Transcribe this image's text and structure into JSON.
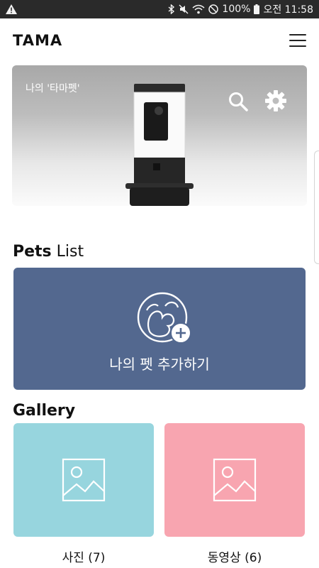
{
  "status_bar": {
    "battery": "100%",
    "time": "오전 11:58"
  },
  "app": {
    "logo": "TAMA"
  },
  "hero": {
    "label": "나의 '타마펫'"
  },
  "pets": {
    "title_bold": "Pets",
    "title_rest": " List",
    "add_label": "나의 펫 추가하기"
  },
  "gallery": {
    "title": "Gallery",
    "photos_label": "사진 (7)",
    "videos_label": "동영상 (6)"
  },
  "colors": {
    "add_pet_card": "#53688f",
    "photos_card": "#97d5de",
    "videos_card": "#f8a5b0"
  }
}
